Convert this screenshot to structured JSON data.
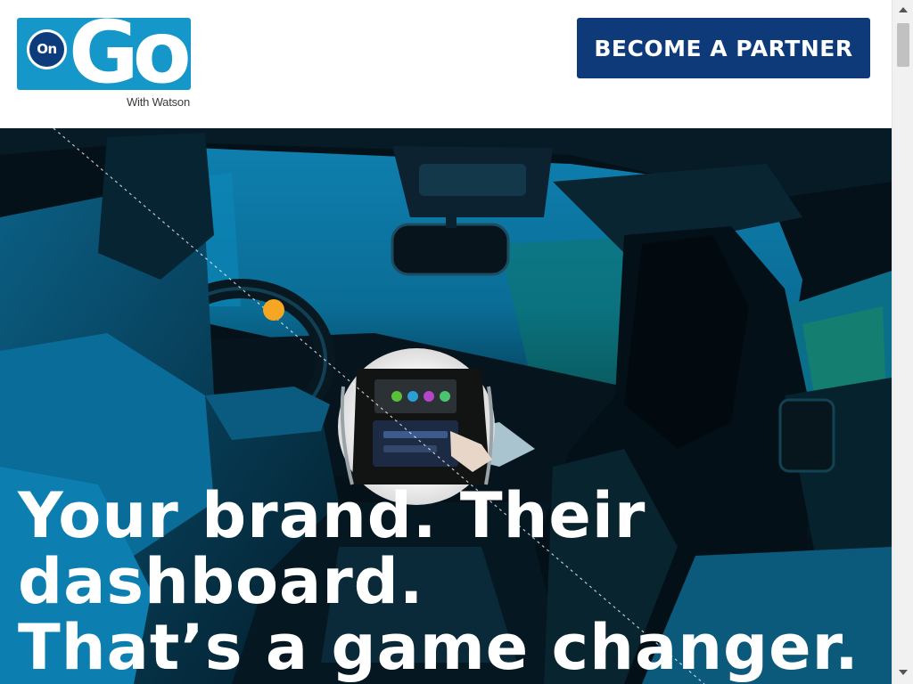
{
  "header": {
    "logo": {
      "badge_text": "On",
      "wordmark": "Go",
      "tagline": "With Watson"
    },
    "cta_label": "BECOME A PARTNER"
  },
  "hero": {
    "heading_lines": [
      "Your brand. Their",
      "dashboard.",
      "That’s a game changer."
    ],
    "image_description_icon": "car-interior-photo",
    "accent_color": "#f5a623"
  },
  "colors": {
    "brand_blue": "#1597c9",
    "button_navy": "#0e3a7a",
    "hero_tint": "#0b6f9a"
  }
}
